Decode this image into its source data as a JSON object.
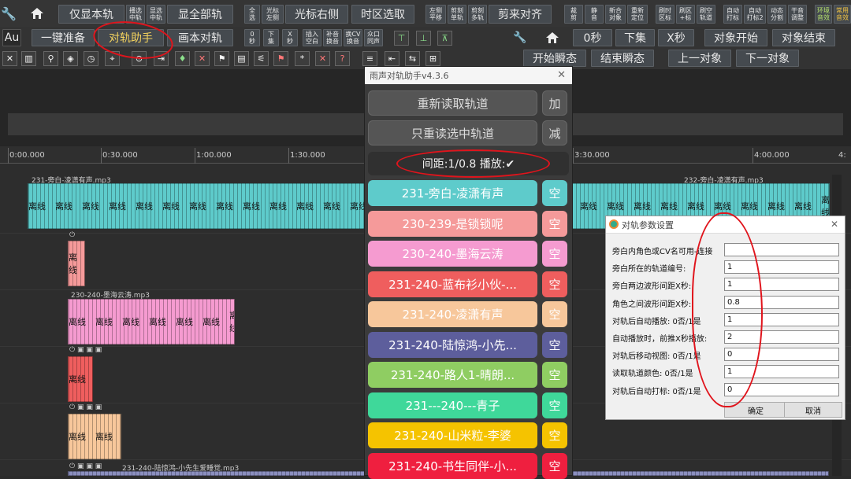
{
  "toolbar_row1": {
    "only_this_track": "仅显本轨",
    "play_mid_lbl": "播选\n中轨",
    "show_mid_lbl": "显选\n中轨",
    "show_all": "显全部轨",
    "select_all_lbl": "全\n选",
    "cursor_left_lbl": "光标\n左侧",
    "cursor_right": "光标右侧",
    "region_select": "时区选取",
    "left_move_lbl": "左侧\n平移",
    "cut_single_lbl": "剪刻\n单轨",
    "cut_multi_lbl": "剪刻\n多轨",
    "cut_align": "剪来对齐",
    "cut_lbl": "裁\n剪",
    "mute_lbl": "静\n音",
    "new_align_lbl": "新合\n对象",
    "reposition_lbl": "重新\n定位",
    "time_region_lbl": "刷时\n区标",
    "region_mark_lbl": "刷区\n+标",
    "region_track_lbl": "刷空\n轨道",
    "auto_mark_lbl": "自动\n打标",
    "auto_mark2_lbl": "自动\n打标2",
    "dynamic_split_lbl": "动态\n分割",
    "dry_adjust_lbl": "干音\n调整",
    "env_audio_lbl": "环境\n音效",
    "common_audio_lbl": "常用\n音效"
  },
  "toolbar_row2": {
    "au_label": "Au",
    "one_click_prep": "一键准备",
    "align_helper": "对轨助手",
    "script_align": "画本对轨",
    "zero_sec_lbl": "0\n秒",
    "next_set_lbl": "下\n集",
    "x_sec_lbl": "X\n秒",
    "insert_blank_lbl": "插入\n空白",
    "replace_sound_lbl": "补音\n换音",
    "replace_cv_lbl": "换CV\n换音",
    "same_sound_lbl": "众口\n同声",
    "zero_sec": "0秒",
    "next_set": "下集",
    "x_sec": "X秒",
    "object_start": "对象开始",
    "object_end": "对象结束"
  },
  "toolbar_row3": {
    "start_moment": "开始瞬态",
    "end_moment": "结束瞬态",
    "prev_object": "上一对象",
    "next_object": "下一对象"
  },
  "ruler": {
    "ticks": [
      "0:00.000",
      "0:30.000",
      "1:00.000",
      "1:30.000",
      "3:30.000",
      "4:00.000",
      "4:"
    ]
  },
  "tracks": {
    "track1_title": "231-旁白-凌潇有声.mp3",
    "track1_title_right": "232-旁白-凌潇有声.mp3",
    "track2_title": "230-240-墨海云涛.mp3",
    "track3_title": "231-240-陆惊鸿-小先生爱睡觉.mp3",
    "clip_label": "离线"
  },
  "helper_dialog": {
    "title": "雨声对轨助手v4.3.6",
    "reload_tracks": "重新读取轨道",
    "add": "加",
    "reload_selected": "只重读选中轨道",
    "subtract": "减",
    "spacing": "间距:1/0.8  播放:✔",
    "empty": "空",
    "track_buttons": [
      {
        "label": "231-旁白-凌潇有声",
        "color": "#5ecbcb"
      },
      {
        "label": "230-239-是锁锁呢",
        "color": "#f59a9a"
      },
      {
        "label": "230-240-墨海云涛",
        "color": "#f59bd0"
      },
      {
        "label": "231-240-蓝布衫小伙-...",
        "color": "#ef5e5e"
      },
      {
        "label": "231-240-凌潇有声",
        "color": "#f7c79b"
      },
      {
        "label": "231-240-陆惊鸿-小先...",
        "color": "#5d5e9c"
      },
      {
        "label": "231-240-路人1-晴朗...",
        "color": "#8fcd62"
      },
      {
        "label": "231---240---青子",
        "color": "#3fd89a"
      },
      {
        "label": "231-240-山米粒-李婆",
        "color": "#f5c300"
      },
      {
        "label": "231-240-书生同伴-小...",
        "color": "#ef1f3f"
      }
    ]
  },
  "param_dialog": {
    "title": "对轨参数设置",
    "rows": [
      {
        "label": "旁白内角色或CV名可用-连接",
        "value": ""
      },
      {
        "label": "旁白所在的轨道编号:",
        "value": "1"
      },
      {
        "label": "旁白两边波形间距X秒:",
        "value": "1"
      },
      {
        "label": "角色之间波形间距X秒:",
        "value": "0.8"
      },
      {
        "label": "对轨后自动播放: 0否/1是",
        "value": "1"
      },
      {
        "label": "自动播放时，前推X秒播放:",
        "value": "2"
      },
      {
        "label": "对轨后移动视图: 0否/1是",
        "value": "0"
      },
      {
        "label": "读取轨道颜色: 0否/1是",
        "value": "1"
      },
      {
        "label": "对轨后自动打标: 0否/1是",
        "value": "0"
      }
    ],
    "ok": "确定",
    "cancel": "取消"
  }
}
